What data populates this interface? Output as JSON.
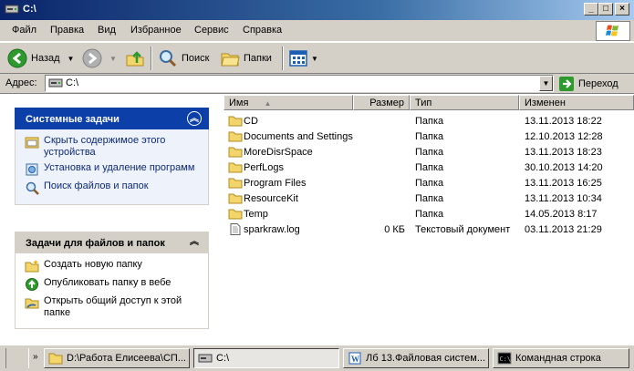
{
  "window": {
    "title": "C:\\"
  },
  "menu": {
    "items": [
      {
        "label": "Файл"
      },
      {
        "label": "Правка"
      },
      {
        "label": "Вид"
      },
      {
        "label": "Избранное"
      },
      {
        "label": "Сервис"
      },
      {
        "label": "Справка"
      }
    ]
  },
  "toolbar": {
    "back_label": "Назад",
    "search_label": "Поиск",
    "folders_label": "Папки"
  },
  "address": {
    "label": "Адрес:",
    "value": "C:\\",
    "go_label": "Переход"
  },
  "system_tasks": {
    "title": "Системные задачи",
    "items": [
      {
        "label": "Скрыть содержимое этого устройства"
      },
      {
        "label": "Установка и удаление программ"
      },
      {
        "label": "Поиск файлов и папок"
      }
    ]
  },
  "file_tasks": {
    "title": "Задачи для файлов и папок",
    "items": [
      {
        "label": "Создать новую папку"
      },
      {
        "label": "Опубликовать папку в вебе"
      },
      {
        "label": "Открыть общий доступ к этой папке"
      }
    ]
  },
  "list": {
    "columns": {
      "name": "Имя",
      "size": "Размер",
      "type": "Тип",
      "modified": "Изменен"
    },
    "rows": [
      {
        "name": "CD",
        "size": "",
        "type": "Папка",
        "modified": "13.11.2013 18:22",
        "kind": "folder"
      },
      {
        "name": "Documents and Settings",
        "size": "",
        "type": "Папка",
        "modified": "12.10.2013 12:28",
        "kind": "folder"
      },
      {
        "name": "MoreDisrSpace",
        "size": "",
        "type": "Папка",
        "modified": "13.11.2013 18:23",
        "kind": "folder"
      },
      {
        "name": "PerfLogs",
        "size": "",
        "type": "Папка",
        "modified": "30.10.2013 14:20",
        "kind": "folder"
      },
      {
        "name": "Program Files",
        "size": "",
        "type": "Папка",
        "modified": "13.11.2013 16:25",
        "kind": "folder"
      },
      {
        "name": "ResourceKit",
        "size": "",
        "type": "Папка",
        "modified": "13.11.2013 10:34",
        "kind": "folder"
      },
      {
        "name": "Temp",
        "size": "",
        "type": "Папка",
        "modified": "14.05.2013 8:17",
        "kind": "folder"
      },
      {
        "name": "sparkraw.log",
        "size": "0 КБ",
        "type": "Текстовый документ",
        "modified": "03.11.2013 21:29",
        "kind": "file"
      }
    ]
  },
  "taskbar": {
    "items": [
      {
        "label": "D:\\Работа Елисеева\\СП...",
        "active": false
      },
      {
        "label": "C:\\",
        "active": true
      },
      {
        "label": "Лб 13.Файловая систем...",
        "active": false
      },
      {
        "label": "Командная строка",
        "active": false
      }
    ]
  },
  "colors": {
    "panel_header": "#0c3fa8",
    "panel_header_light": "#d6dff7",
    "folder": "#f3d66b",
    "face": "#d4d0c8"
  }
}
